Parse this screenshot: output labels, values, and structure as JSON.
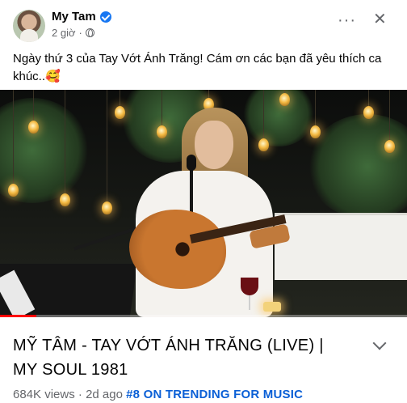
{
  "post": {
    "author": "My Tam",
    "time": "2 giờ",
    "separator": "·",
    "caption": "Ngày thứ 3 của Tay Vớt Ánh Trăng! Cám ơn các bạn đã yêu thích ca khúc..🥰",
    "more_label": "···",
    "close_label": "✕"
  },
  "video": {
    "progress_percent": 9
  },
  "link": {
    "title": "MỸ TÂM - TAY VỚT ÁNH TRĂNG (LIVE) | MY SOUL 1981",
    "views": "684K views",
    "dot1": "·",
    "age": "2d ago",
    "trending": "#8 ON TRENDING FOR MUSIC"
  },
  "colors": {
    "verified": "#1877f2",
    "progress": "#ff0000",
    "trending": "#0a5fd6"
  },
  "icons": [
    "verified-badge-icon",
    "globe-icon",
    "more-options-icon",
    "close-icon",
    "chevron-down-icon"
  ]
}
